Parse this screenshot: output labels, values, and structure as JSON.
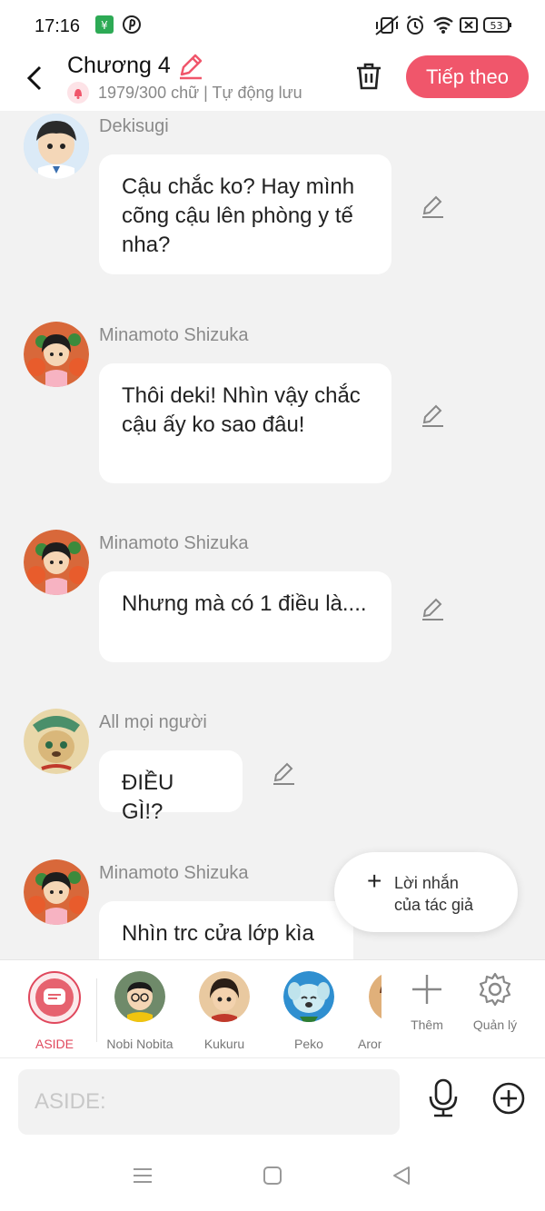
{
  "status_bar": {
    "time": "17:16",
    "battery": "53"
  },
  "header": {
    "title": "Chương 4",
    "subtitle": "1979/300 chữ | Tự động lưu",
    "next_label": "Tiếp theo"
  },
  "messages": [
    {
      "speaker": "Dekisugi",
      "text": "Cậu chắc ko? Hay mình cõng cậu lên phòng y tế nha?",
      "avatar": "dekisugi"
    },
    {
      "speaker": "Minamoto Shizuka",
      "text": "Thôi deki! Nhìn vậy chắc cậu ấy ko sao đâu!",
      "avatar": "shizuka"
    },
    {
      "speaker": "Minamoto Shizuka",
      "text": "Nhưng mà có 1 điều là....",
      "avatar": "shizuka"
    },
    {
      "speaker": "All mọi người",
      "text": "ĐIỀU GÌ!?",
      "avatar": "group"
    },
    {
      "speaker": "Minamoto Shizuka",
      "text": "Nhìn trc cửa lớp kìa",
      "avatar": "shizuka"
    }
  ],
  "author_note": {
    "plus": "+",
    "label_line1": "Lời nhắn",
    "label_line2": "của tác giả"
  },
  "characters": [
    {
      "name": "ASIDE",
      "active": true
    },
    {
      "name": "Nobi Nobita"
    },
    {
      "name": "Kukuru"
    },
    {
      "name": "Peko"
    },
    {
      "name": "Aron"
    }
  ],
  "tools": {
    "add_label": "Thêm",
    "manage_label": "Quản lý"
  },
  "input": {
    "placeholder": "ASIDE:"
  },
  "colors": {
    "accent": "#f0566b",
    "background": "#f2f2f2"
  }
}
